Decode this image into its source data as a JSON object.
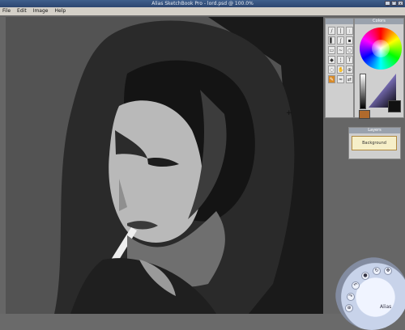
{
  "window": {
    "title": "Alias SketchBook Pro - lord.psd @ 100.0%",
    "controls": [
      "_",
      "□",
      "x"
    ]
  },
  "menu": [
    {
      "label": "File"
    },
    {
      "label": "Edit"
    },
    {
      "label": "Image"
    },
    {
      "label": "Help"
    }
  ],
  "toolbox": {
    "tools": [
      "pen-icon",
      "pencil-icon",
      "airbrush-icon",
      "marker-icon",
      "brush-icon",
      "paint-icon",
      "eraser-icon",
      "smudge-icon",
      "blur-icon",
      "fill-icon",
      "dropper-icon",
      "text-icon",
      "lasso-icon",
      "hand-icon",
      "zoom-icon",
      "pick-icon",
      "blend-icon",
      "flip-icon"
    ],
    "active_index": 15
  },
  "colors": {
    "primary": "#b06a2c",
    "secondary": "#111111",
    "title": "Colors"
  },
  "layers": {
    "title": "Layers",
    "thumb_label": "Background"
  },
  "lagoon": {
    "labels": [
      "Alias"
    ]
  }
}
